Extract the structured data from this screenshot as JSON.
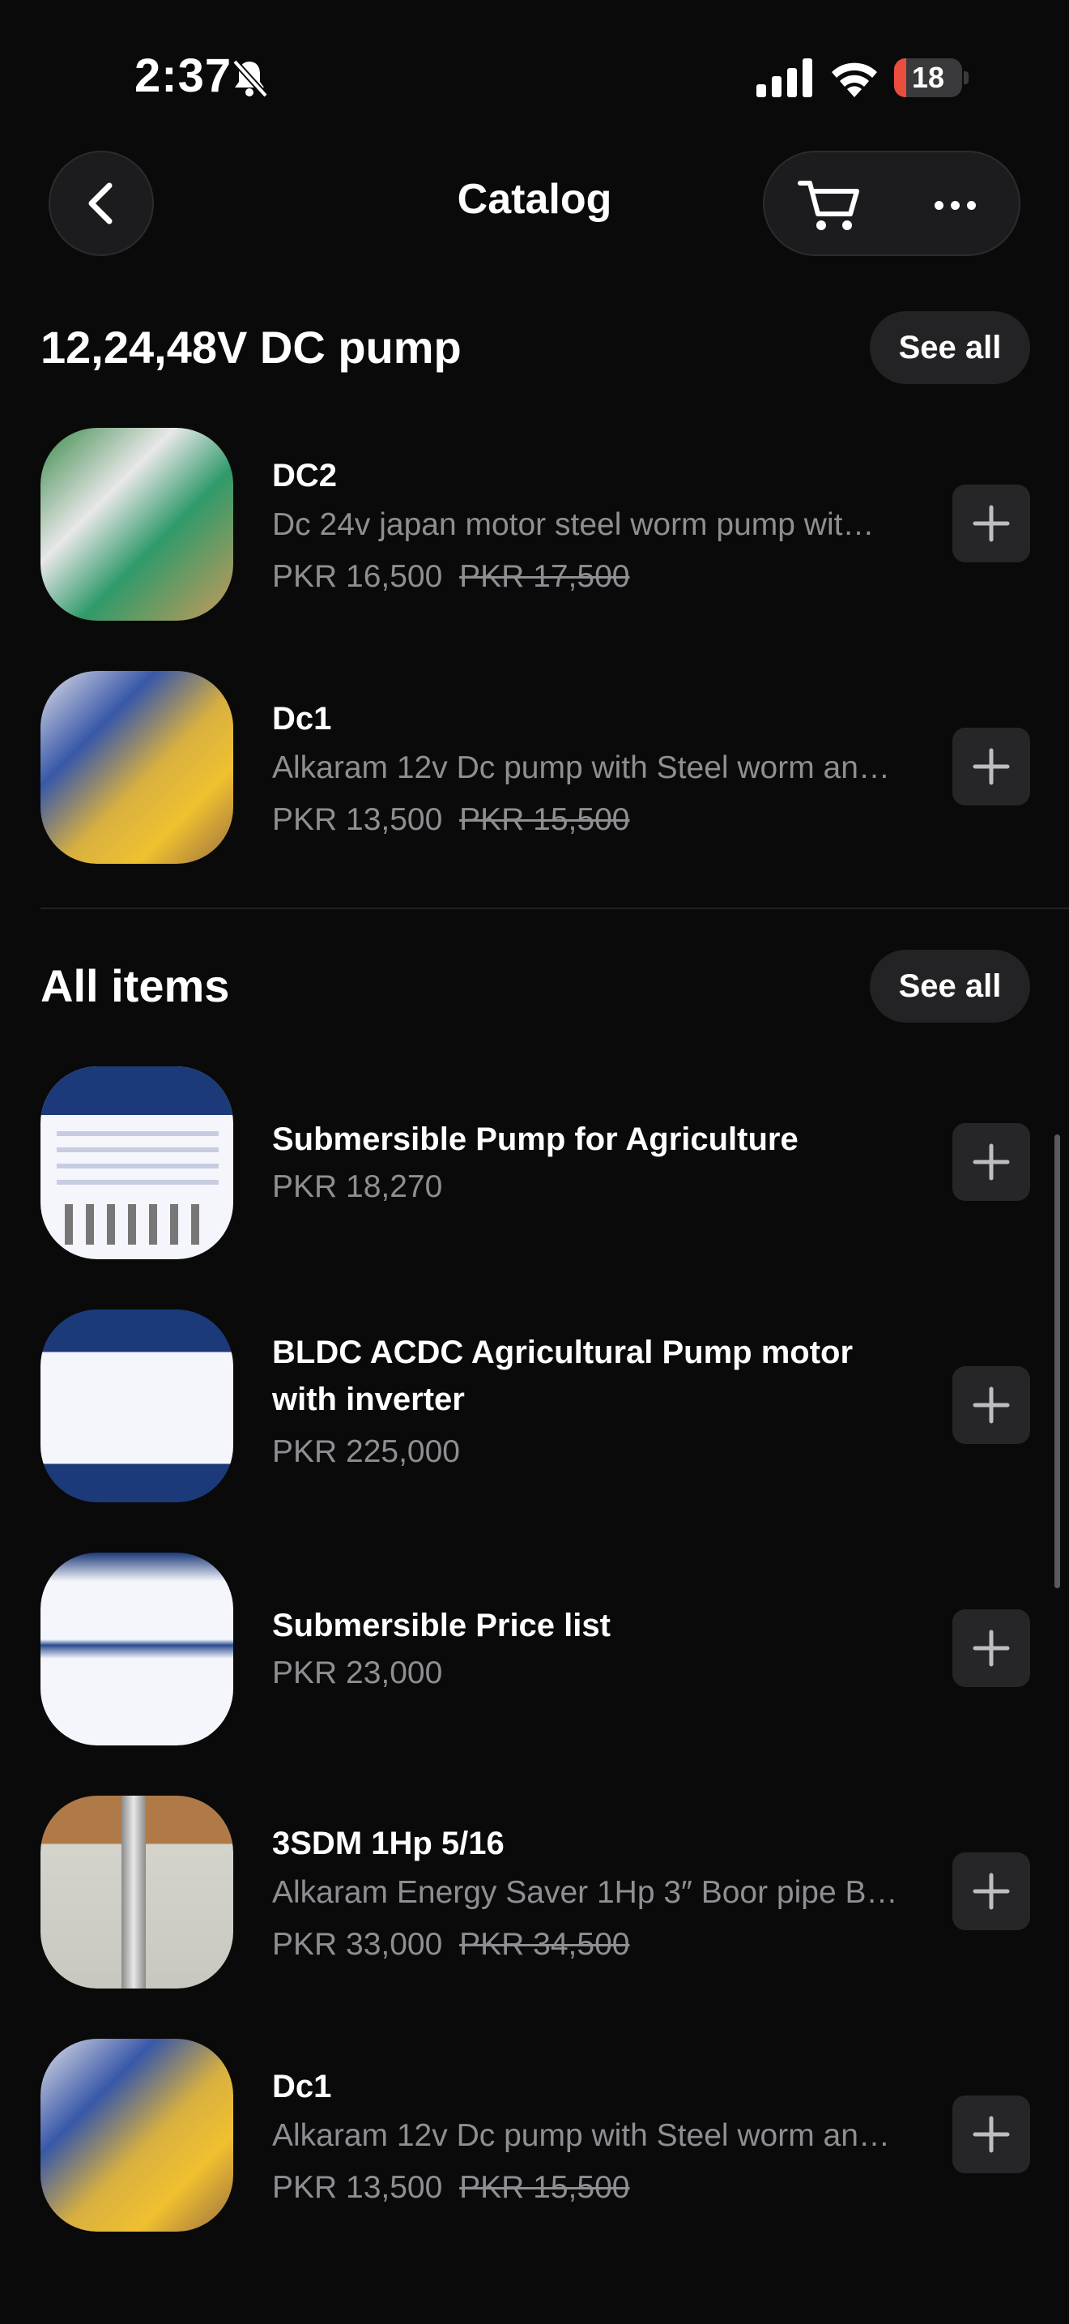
{
  "status_bar": {
    "time": "2:37",
    "battery_percent": "18",
    "battery_level": 0.18
  },
  "nav": {
    "title": "Catalog"
  },
  "sections": [
    {
      "title": "12,24,48V DC pump",
      "see_all_label": "See all",
      "items": [
        {
          "name": "DC2",
          "description": "Dc 24v japan motor steel worm pump wit…",
          "price": "PKR 16,500",
          "old_price": "PKR 17,500"
        },
        {
          "name": "Dc1",
          "description": "Alkaram 12v Dc pump with Steel worm an…",
          "price": "PKR 13,500",
          "old_price": "PKR 15,500"
        }
      ]
    },
    {
      "title": "All items",
      "see_all_label": "See all",
      "items": [
        {
          "name": "Submersible Pump for Agriculture",
          "price": "PKR 18,270"
        },
        {
          "name": "BLDC ACDC Agricultural Pump motor with inverter",
          "price": "PKR 225,000"
        },
        {
          "name": "Submersible Price list",
          "price": "PKR 23,000"
        },
        {
          "name": "3SDM 1Hp  5/16",
          "description": "Alkaram Energy Saver 1Hp 3″ Boor pipe B…",
          "price": "PKR 33,000",
          "old_price": "PKR 34,500"
        },
        {
          "name": "Dc1",
          "description": "Alkaram 12v Dc pump with Steel worm an…",
          "price": "PKR 13,500",
          "old_price": "PKR 15,500"
        }
      ]
    }
  ],
  "icons": {
    "back": "chevron-left-icon",
    "cart": "cart-icon",
    "more": "more-horizontal-icon",
    "add": "plus-icon",
    "bell": "bell-slash-icon",
    "signal": "cellular-signal-icon",
    "wifi": "wifi-icon",
    "battery": "battery-icon"
  },
  "colors": {
    "background": "#0a0a0a",
    "surface": "#1c1c1e",
    "secondary_text": "#8e8e93",
    "battery_low": "#eb4e3d"
  }
}
